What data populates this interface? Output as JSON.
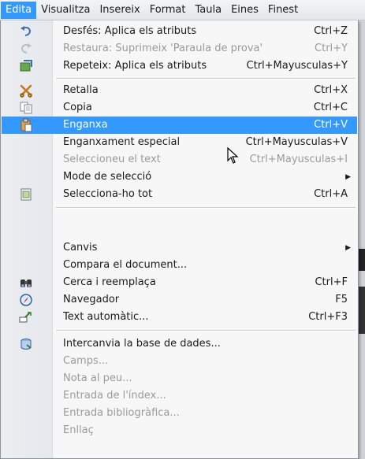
{
  "menubar": {
    "items": [
      {
        "label": "Edita",
        "active": true
      },
      {
        "label": "Visualitza"
      },
      {
        "label": "Insereix"
      },
      {
        "label": "Format"
      },
      {
        "label": "Taula"
      },
      {
        "label": "Eines"
      },
      {
        "label": "Finest"
      }
    ]
  },
  "menu": {
    "items": [
      {
        "label": "Desfés: Aplica els atributs",
        "accel": "Ctrl+Z",
        "icon": "undo-icon"
      },
      {
        "label": "Restaura: Suprimeix 'Paraula de prova'",
        "accel": "Ctrl+Y",
        "icon": "redo-icon"
      },
      {
        "label": "Repeteix: Aplica els atributs",
        "accel": "Ctrl+Mayusculas+Y",
        "icon": "repeat-icon"
      },
      {
        "label": "Retalla",
        "accel": "Ctrl+X",
        "icon": "scissors-icon"
      },
      {
        "label": "Copia",
        "accel": "Ctrl+C",
        "icon": "copy-icon"
      },
      {
        "label": "Enganxa",
        "accel": "Ctrl+V",
        "icon": "paste-icon"
      },
      {
        "label": "Enganxament especial",
        "accel": "Ctrl+Mayusculas+V"
      },
      {
        "label": "Seleccioneu el text",
        "accel": "Ctrl+Mayusculas+I"
      },
      {
        "label": "Mode de selecció"
      },
      {
        "label": "Selecciona-ho tot",
        "accel": "Ctrl+A",
        "icon": "select-all-icon"
      },
      {
        "label": "Canvis"
      },
      {
        "label": "Compara el document..."
      },
      {
        "label": "Cerca i reemplaça",
        "accel": "Ctrl+F",
        "icon": "binoculars-icon"
      },
      {
        "label": "Navegador",
        "accel": "F5",
        "icon": "compass-icon"
      },
      {
        "label": "Text automàtic...",
        "accel": "Ctrl+F3",
        "icon": "autotext-icon"
      },
      {
        "label": "Intercanvia la base de dades...",
        "icon": "database-icon"
      },
      {
        "label": "Camps..."
      },
      {
        "label": "Nota al peu..."
      },
      {
        "label": "Entrada de l'índex..."
      },
      {
        "label": "Entrada bibliogràfica..."
      },
      {
        "label": "Enllaç"
      }
    ]
  },
  "colors": {
    "highlight": "#3399ff",
    "disabled_text": "#9a9a9a"
  }
}
